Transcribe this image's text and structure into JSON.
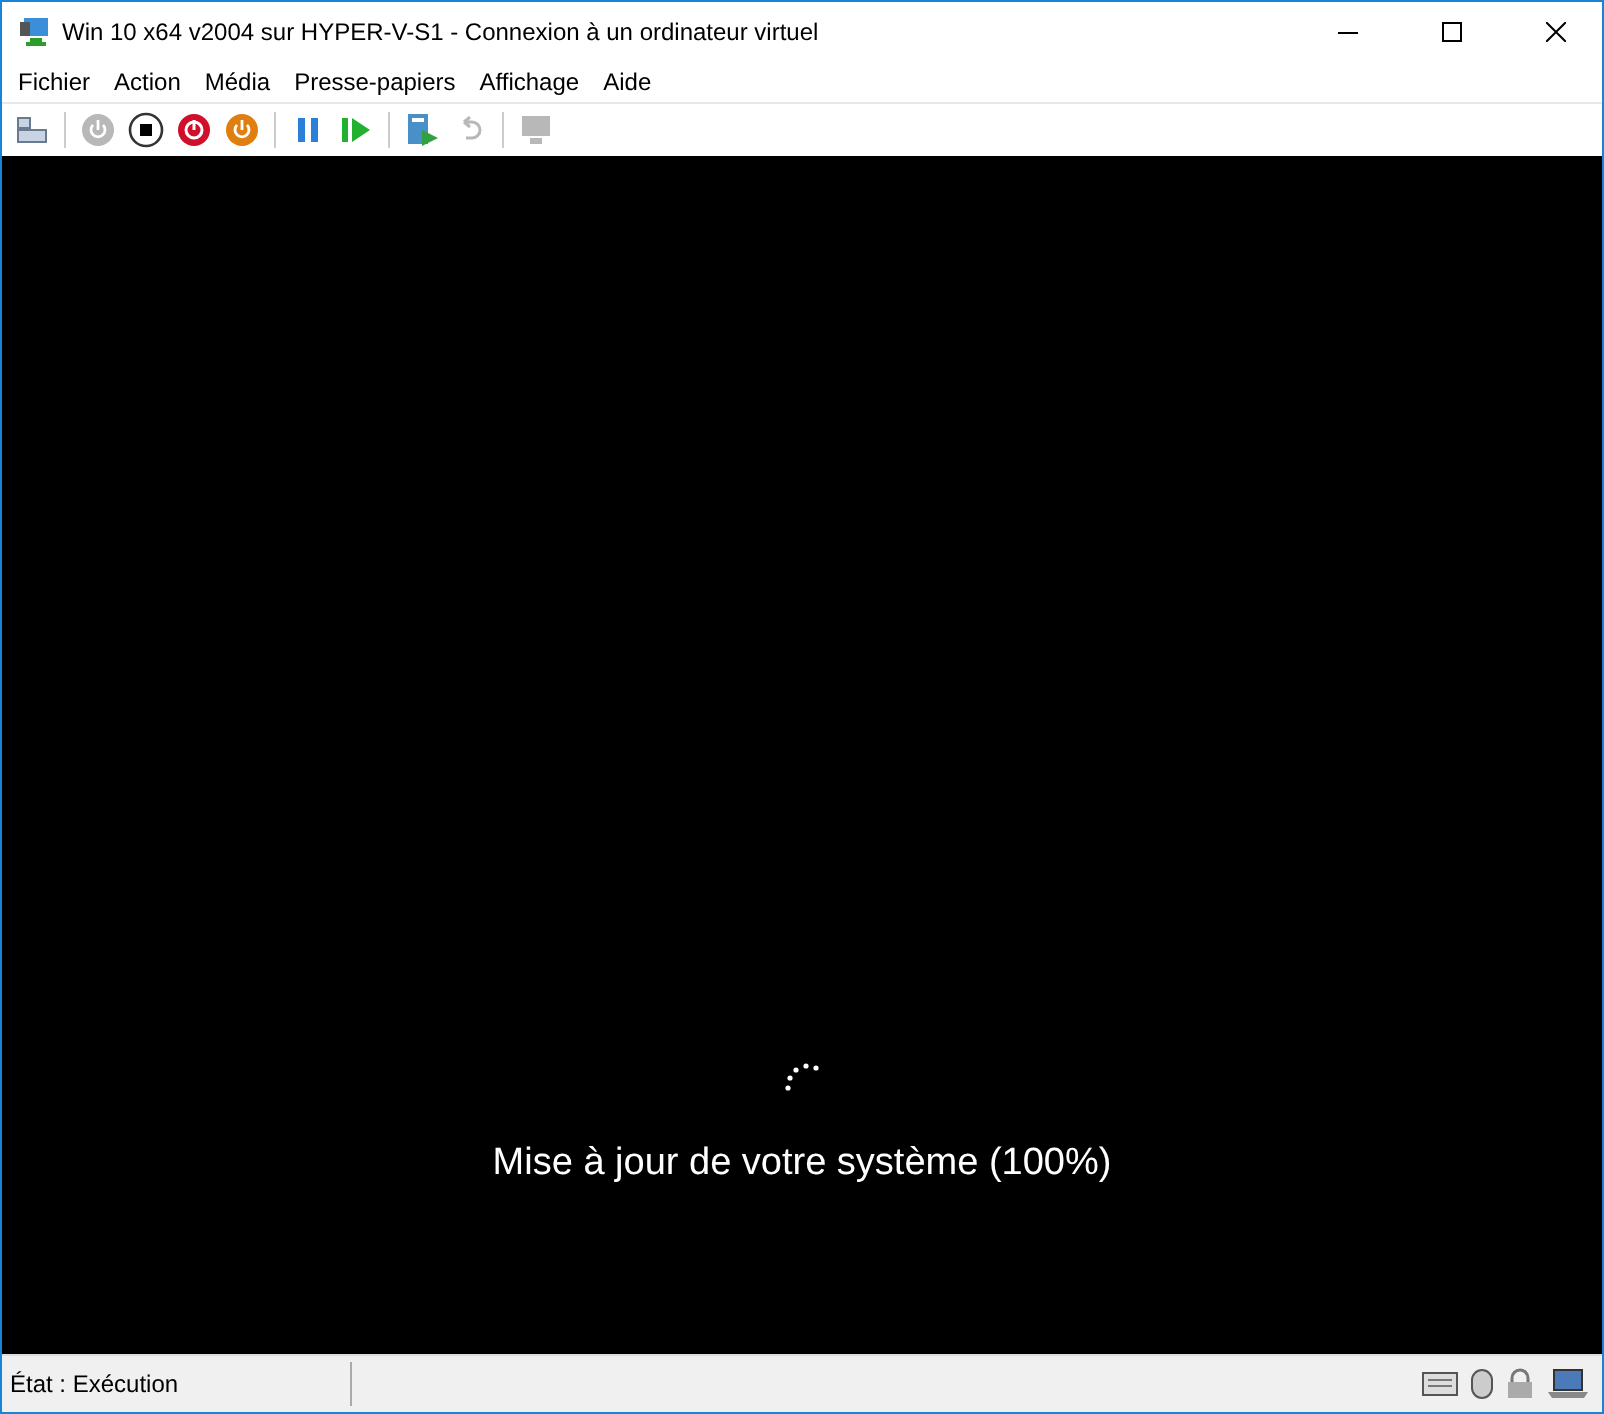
{
  "window": {
    "title": "Win 10 x64 v2004 sur HYPER-V-S1 - Connexion à un ordinateur virtuel"
  },
  "menu": [
    "Fichier",
    "Action",
    "Média",
    "Presse-papiers",
    "Affichage",
    "Aide"
  ],
  "toolbar": [
    {
      "kind": "ctrl-alt-del",
      "disabled": false
    },
    {
      "kind": "sep"
    },
    {
      "kind": "start",
      "disabled": true
    },
    {
      "kind": "turn-off",
      "disabled": false
    },
    {
      "kind": "shut-down",
      "disabled": false
    },
    {
      "kind": "save",
      "disabled": false
    },
    {
      "kind": "sep"
    },
    {
      "kind": "pause",
      "disabled": false
    },
    {
      "kind": "reset",
      "disabled": false
    },
    {
      "kind": "sep"
    },
    {
      "kind": "checkpoint",
      "disabled": false
    },
    {
      "kind": "revert",
      "disabled": true
    },
    {
      "kind": "sep"
    },
    {
      "kind": "enhanced-session",
      "disabled": true
    }
  ],
  "screen": {
    "message": "Mise à jour de votre système (100%)"
  },
  "status_bar": {
    "text": "État : Exécution"
  }
}
